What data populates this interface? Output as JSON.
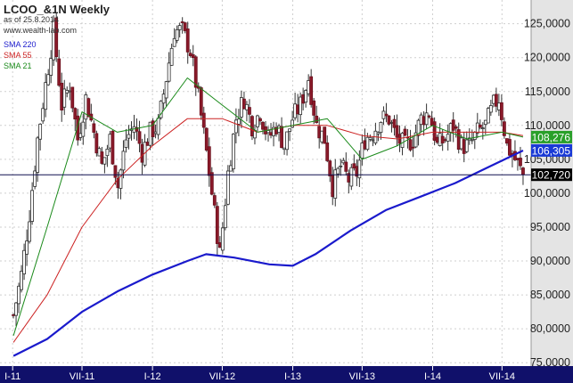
{
  "header": {
    "title": "LCOO_&1N Weekly",
    "date_line": "as of 25.8.2014",
    "site": "www.wealth-lab.com"
  },
  "legend": [
    {
      "label": "SMA 220",
      "color": "#1a1acc"
    },
    {
      "label": "SMA 55",
      "color": "#cc2222"
    },
    {
      "label": "SMA 21",
      "color": "#1a8a1a"
    }
  ],
  "chart_data": {
    "type": "candlestick",
    "x_ticks": [
      "I-11",
      "VII-11",
      "I-12",
      "VII-12",
      "I-13",
      "VII-13",
      "I-14",
      "VII-14"
    ],
    "y_ticks": [
      "75,0000",
      "80,0000",
      "85,0000",
      "90,0000",
      "95,0000",
      "100,0000",
      "105,0000",
      "110,0000",
      "115,0000",
      "120,0000",
      "125,0000"
    ],
    "ylim": [
      74.5,
      128.5
    ],
    "grid": true,
    "legend_position": "top-left",
    "horizontal_line": 102.72,
    "price_markers": [
      {
        "label": "108,276",
        "value": 108.276,
        "color": "#2aa02a"
      },
      {
        "label": "106,305",
        "value": 106.305,
        "color": "#1a3ad6"
      },
      {
        "label": "102,720",
        "value": 102.72,
        "color": "#000000"
      }
    ],
    "price_path": [
      [
        "2011-01-03",
        82
      ],
      [
        "2011-01-24",
        88
      ],
      [
        "2011-02-14",
        97
      ],
      [
        "2011-03-07",
        108
      ],
      [
        "2011-03-28",
        116
      ],
      [
        "2011-04-18",
        124
      ],
      [
        "2011-05-09",
        113
      ],
      [
        "2011-05-30",
        116
      ],
      [
        "2011-06-20",
        108
      ],
      [
        "2011-07-11",
        114
      ],
      [
        "2011-08-01",
        109
      ],
      [
        "2011-08-22",
        104
      ],
      [
        "2011-09-12",
        108
      ],
      [
        "2011-10-03",
        101
      ],
      [
        "2011-10-24",
        108
      ],
      [
        "2011-11-14",
        110
      ],
      [
        "2011-12-05",
        106
      ],
      [
        "2011-12-26",
        109
      ],
      [
        "2012-01-16",
        110
      ],
      [
        "2012-02-06",
        117
      ],
      [
        "2012-02-27",
        124
      ],
      [
        "2012-03-19",
        124
      ],
      [
        "2012-04-09",
        121
      ],
      [
        "2012-04-30",
        114
      ],
      [
        "2012-05-21",
        106
      ],
      [
        "2012-06-11",
        97
      ],
      [
        "2012-06-25",
        91
      ],
      [
        "2012-07-16",
        103
      ],
      [
        "2012-08-06",
        111
      ],
      [
        "2012-08-27",
        114
      ],
      [
        "2012-09-17",
        110
      ],
      [
        "2012-10-08",
        112
      ],
      [
        "2012-10-29",
        108
      ],
      [
        "2012-11-19",
        110
      ],
      [
        "2012-12-10",
        107
      ],
      [
        "2012-12-31",
        111
      ],
      [
        "2013-01-21",
        113
      ],
      [
        "2013-02-11",
        117
      ],
      [
        "2013-03-04",
        110
      ],
      [
        "2013-03-25",
        108
      ],
      [
        "2013-04-15",
        101
      ],
      [
        "2013-05-06",
        104
      ],
      [
        "2013-05-27",
        102
      ],
      [
        "2013-06-17",
        103
      ],
      [
        "2013-07-08",
        108
      ],
      [
        "2013-07-29",
        109
      ],
      [
        "2013-08-19",
        111
      ],
      [
        "2013-09-09",
        111
      ],
      [
        "2013-09-30",
        108
      ],
      [
        "2013-10-21",
        107
      ],
      [
        "2013-11-11",
        108
      ],
      [
        "2013-12-02",
        111
      ],
      [
        "2013-12-23",
        112
      ],
      [
        "2014-01-13",
        107
      ],
      [
        "2014-02-03",
        108
      ],
      [
        "2014-02-24",
        110
      ],
      [
        "2014-03-17",
        107
      ],
      [
        "2014-04-07",
        107
      ],
      [
        "2014-04-28",
        109
      ],
      [
        "2014-05-19",
        110
      ],
      [
        "2014-06-09",
        113
      ],
      [
        "2014-06-23",
        114
      ],
      [
        "2014-07-14",
        107
      ],
      [
        "2014-08-04",
        105
      ],
      [
        "2014-08-25",
        102.72
      ]
    ],
    "series": [
      {
        "name": "SMA 220",
        "color": "#1a1acc",
        "points": [
          [
            "2011-01-03",
            76
          ],
          [
            "2011-04-01",
            78.5
          ],
          [
            "2011-07-01",
            82.5
          ],
          [
            "2011-10-01",
            85.5
          ],
          [
            "2012-01-01",
            88
          ],
          [
            "2012-04-01",
            90
          ],
          [
            "2012-05-20",
            91
          ],
          [
            "2012-08-01",
            90.5
          ],
          [
            "2012-11-01",
            89.5
          ],
          [
            "2013-01-01",
            89.3
          ],
          [
            "2013-03-01",
            91
          ],
          [
            "2013-06-01",
            94.5
          ],
          [
            "2013-09-01",
            97.5
          ],
          [
            "2013-12-01",
            99.5
          ],
          [
            "2014-03-01",
            101.5
          ],
          [
            "2014-06-01",
            104
          ],
          [
            "2014-08-25",
            106.3
          ]
        ]
      },
      {
        "name": "SMA 55",
        "color": "#cc2222",
        "points": [
          [
            "2011-01-03",
            78
          ],
          [
            "2011-04-01",
            85
          ],
          [
            "2011-07-01",
            95
          ],
          [
            "2011-10-01",
            102
          ],
          [
            "2012-01-01",
            107
          ],
          [
            "2012-04-01",
            111
          ],
          [
            "2012-07-01",
            111
          ],
          [
            "2012-10-01",
            109
          ],
          [
            "2013-01-01",
            110
          ],
          [
            "2013-04-01",
            110
          ],
          [
            "2013-07-01",
            108.5
          ],
          [
            "2013-10-01",
            108
          ],
          [
            "2014-01-01",
            109
          ],
          [
            "2014-04-01",
            109
          ],
          [
            "2014-07-01",
            109
          ],
          [
            "2014-08-25",
            108.5
          ]
        ]
      },
      {
        "name": "SMA 21",
        "color": "#1a8a1a",
        "points": [
          [
            "2011-01-03",
            79
          ],
          [
            "2011-04-01",
            95
          ],
          [
            "2011-07-01",
            112
          ],
          [
            "2011-10-01",
            109
          ],
          [
            "2012-01-01",
            110
          ],
          [
            "2012-04-01",
            117
          ],
          [
            "2012-07-01",
            113
          ],
          [
            "2012-10-01",
            109
          ],
          [
            "2013-01-01",
            110
          ],
          [
            "2013-04-01",
            111
          ],
          [
            "2013-07-01",
            105
          ],
          [
            "2013-10-01",
            107
          ],
          [
            "2014-01-01",
            110
          ],
          [
            "2014-04-01",
            108
          ],
          [
            "2014-07-01",
            109
          ],
          [
            "2014-08-25",
            108.276
          ]
        ]
      }
    ]
  }
}
